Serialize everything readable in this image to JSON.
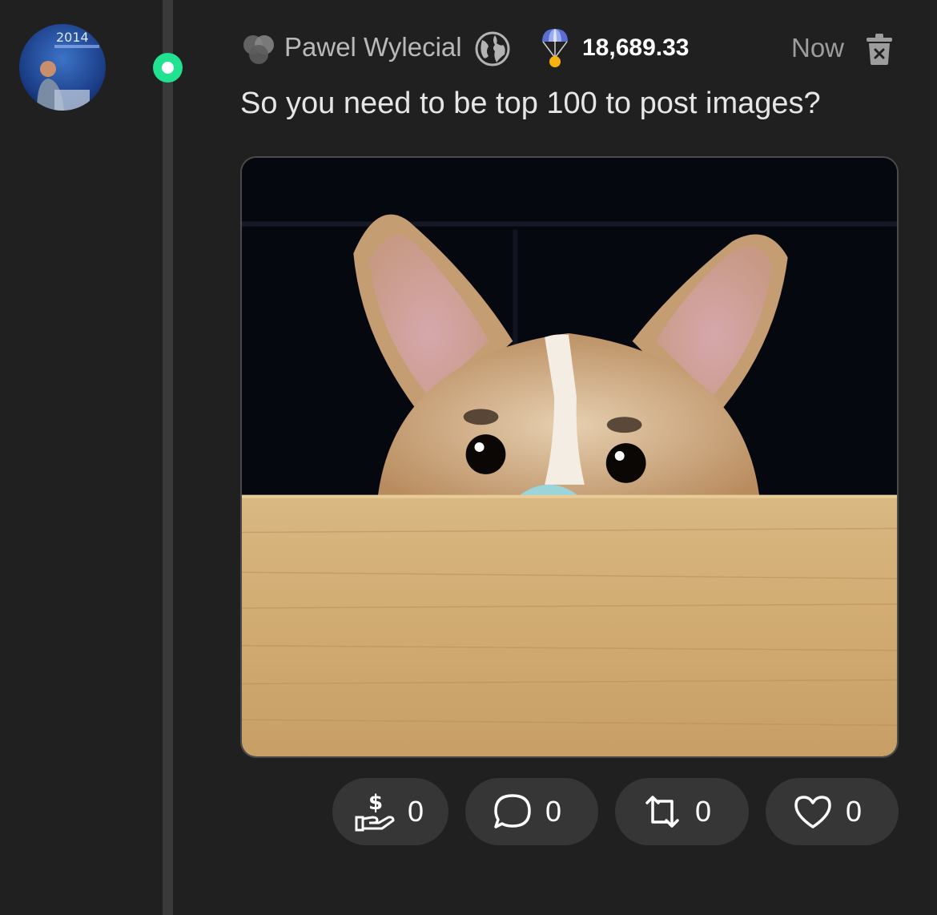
{
  "post": {
    "author": "Pawel Wylecial",
    "balance": "18,689.33",
    "timestamp": "Now",
    "text": "So you need to be top 100 to post images?",
    "avatar_caption": "2014",
    "image_alt": "corgi peeking over wooden table"
  },
  "actions": {
    "tip": {
      "icon": "hand-dollar-icon",
      "count": "0"
    },
    "comment": {
      "icon": "comment-icon",
      "count": "0"
    },
    "repost": {
      "icon": "repost-icon",
      "count": "0"
    },
    "like": {
      "icon": "heart-icon",
      "count": "0"
    }
  },
  "colors": {
    "background": "#202020",
    "online": "#20e291",
    "button_bg": "#363636",
    "thread_line": "#3a3a3a"
  }
}
